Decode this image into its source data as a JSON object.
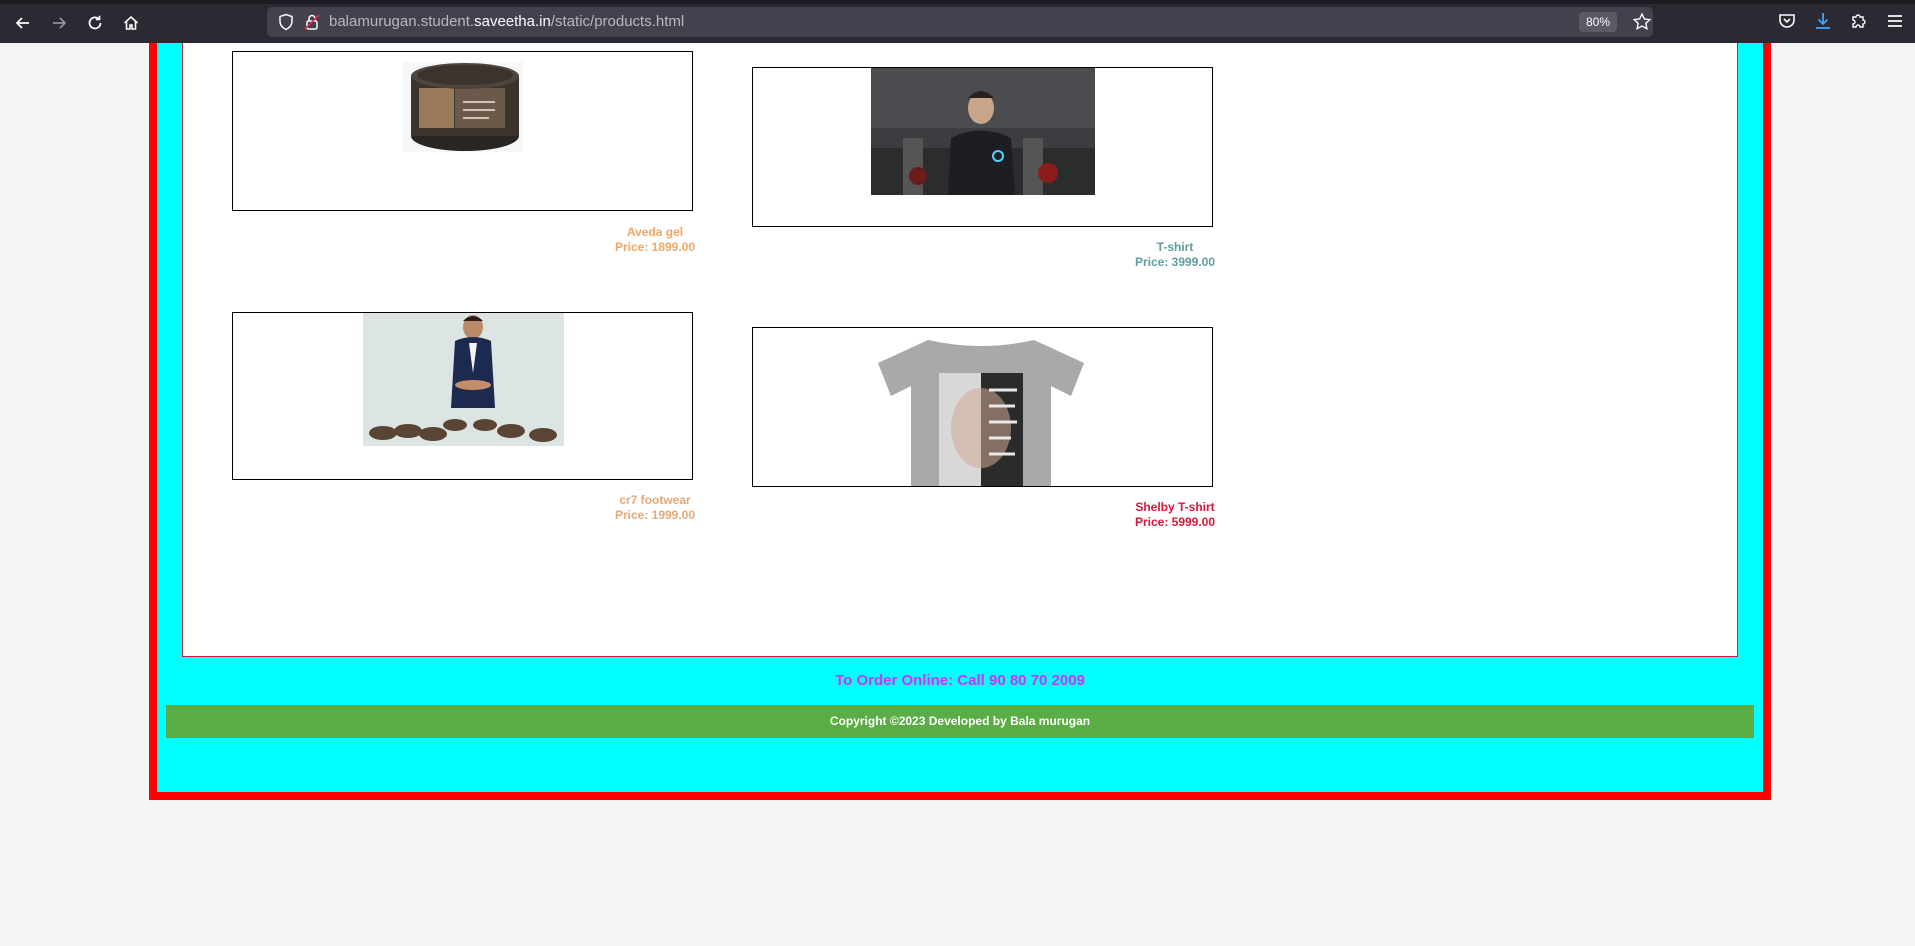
{
  "browser": {
    "url_prefix": "balamurugan.student.",
    "url_host": "saveetha.in",
    "url_path": "/static/products.html",
    "zoom": "80%"
  },
  "products": [
    {
      "name": "Aveda gel",
      "price": "Price: 1899.00",
      "color": "#f4a460",
      "image": "aveda-gel-jar"
    },
    {
      "name": "T-shirt",
      "price": "Price: 3999.00",
      "color": "#5f9ea0",
      "image": "tshirt-man-photo"
    },
    {
      "name": "cr7 footwear",
      "price": "Price: 1999.00",
      "color": "#e9a875",
      "image": "cr7-footwear-photo"
    },
    {
      "name": "Shelby T-shirt",
      "price": "Price: 5999.00",
      "color": "#dc143c",
      "image": "shelby-tshirt-photo"
    }
  ],
  "order_text": "To Order Online: Call 90 80 70 2009",
  "footer_text": "Copyright ©2023 Developed by Bala murugan",
  "colors": {
    "page_background": "#00ffff",
    "frame_border": "#ff0000",
    "footer_background": "#5aad45",
    "order_text": "#cc33ff"
  }
}
